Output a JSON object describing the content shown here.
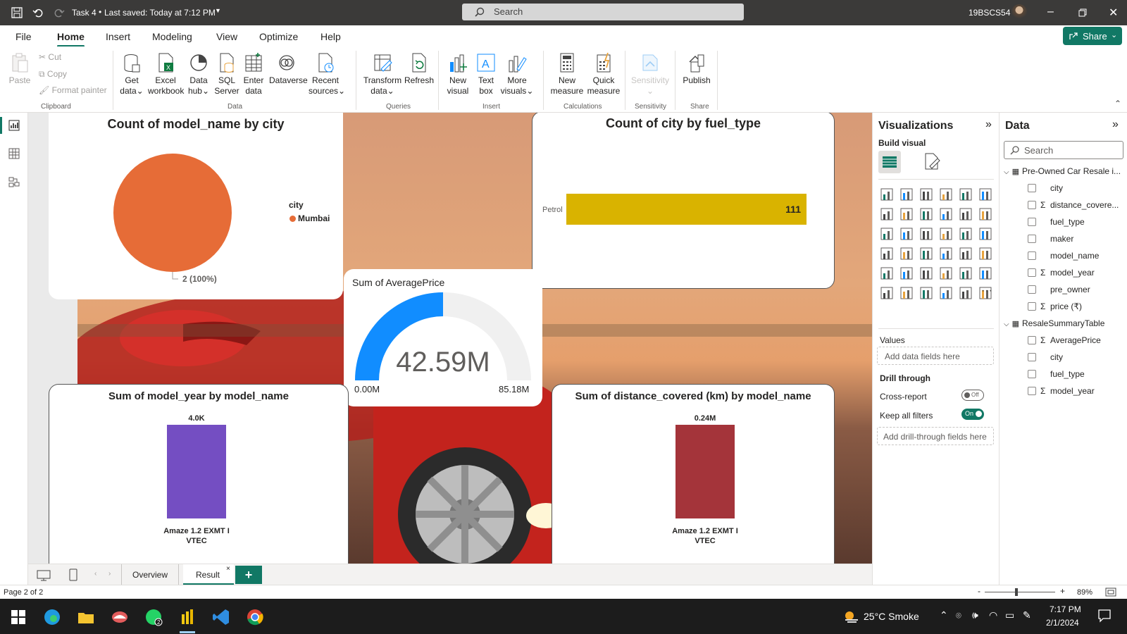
{
  "titlebar": {
    "doc_title": "Task 4",
    "saved": "Last saved: Today at 7:12 PM",
    "search_placeholder": "Search",
    "user": "19BSCS54"
  },
  "menu": {
    "items": [
      "File",
      "Home",
      "Insert",
      "Modeling",
      "View",
      "Optimize",
      "Help"
    ],
    "share": "Share"
  },
  "ribbon": {
    "clipboard": {
      "paste": "Paste",
      "cut": "Cut",
      "copy": "Copy",
      "format_painter": "Format painter",
      "group": "Clipboard"
    },
    "data": {
      "get_data": [
        "Get",
        "data"
      ],
      "excel": [
        "Excel",
        "workbook"
      ],
      "data_hub": [
        "Data",
        "hub"
      ],
      "sql": [
        "SQL",
        "Server"
      ],
      "enter": [
        "Enter",
        "data"
      ],
      "dataverse": "Dataverse",
      "recent": [
        "Recent",
        "sources"
      ],
      "group": "Data"
    },
    "queries": {
      "transform": [
        "Transform",
        "data"
      ],
      "refresh": "Refresh",
      "group": "Queries"
    },
    "insert": {
      "new_visual": [
        "New",
        "visual"
      ],
      "text_box": [
        "Text",
        "box"
      ],
      "more_visuals": [
        "More",
        "visuals"
      ],
      "group": "Insert"
    },
    "calculations": {
      "new_measure": [
        "New",
        "measure"
      ],
      "quick_measure": [
        "Quick",
        "measure"
      ],
      "group": "Calculations"
    },
    "sensitivity": {
      "label": "Sensitivity",
      "group": "Sensitivity"
    },
    "share": {
      "publish": "Publish",
      "group": "Share"
    }
  },
  "visuals": {
    "pie": {
      "title": "Count of model_name by city",
      "legend_title": "city",
      "legend_item": "Mumbai",
      "data_label": "2 (100%)",
      "color": "#E66C37"
    },
    "fuel_bar": {
      "title": "Count of city by fuel_type",
      "color": "#D9B300"
    },
    "gauge": {
      "title": "Sum of AveragePrice",
      "value_label": "42.59M",
      "min_label": "0.00M",
      "max_label": "85.18M",
      "color": "#118DFF"
    },
    "year_bar": {
      "title": "Sum of model_year by model_name",
      "color": "#744EC2"
    },
    "distance_bar": {
      "title": "Sum of distance_covered (km) by model_name",
      "color": "#A4343A"
    }
  },
  "chart_data": [
    {
      "type": "pie",
      "title": "Count of model_name by city",
      "categories": [
        "Mumbai"
      ],
      "values": [
        2
      ],
      "legend": "right"
    },
    {
      "type": "bar",
      "orientation": "horizontal",
      "title": "Count of city by fuel_type",
      "categories": [
        "Petrol"
      ],
      "values": [
        111
      ],
      "value_labels": [
        "111"
      ]
    },
    {
      "type": "gauge",
      "title": "Sum of AveragePrice",
      "value": 42.59,
      "min": 0,
      "max": 85.18,
      "unit": "M"
    },
    {
      "type": "bar",
      "title": "Sum of model_year by model_name",
      "categories": [
        "Amaze 1.2 EXMT I VTEC"
      ],
      "values": [
        4000
      ],
      "value_labels": [
        "4.0K"
      ]
    },
    {
      "type": "bar",
      "title": "Sum of distance_covered (km) by model_name",
      "categories": [
        "Amaze 1.2 EXMT I VTEC"
      ],
      "values": [
        240000
      ],
      "value_labels": [
        "0.24M"
      ]
    }
  ],
  "viz_pane": {
    "title": "Visualizations",
    "build_visual": "Build visual",
    "values_label": "Values",
    "add_fields": "Add data fields here",
    "drill_through": "Drill through",
    "cross_report": "Cross-report",
    "cross_report_state": "Off",
    "keep_filters": "Keep all filters",
    "keep_filters_state": "On",
    "add_drill": "Add drill-through fields here"
  },
  "data_pane": {
    "title": "Data",
    "search_placeholder": "Search",
    "tables": [
      {
        "name": "Pre-Owned Car Resale i...",
        "fields": [
          {
            "name": "city",
            "sigma": false
          },
          {
            "name": "distance_covere...",
            "sigma": true
          },
          {
            "name": "fuel_type",
            "sigma": false
          },
          {
            "name": "maker",
            "sigma": false
          },
          {
            "name": "model_name",
            "sigma": false
          },
          {
            "name": "model_year",
            "sigma": true
          },
          {
            "name": "pre_owner",
            "sigma": false
          },
          {
            "name": "price (₹)",
            "sigma": true
          }
        ]
      },
      {
        "name": "ResaleSummaryTable",
        "fields": [
          {
            "name": "AveragePrice",
            "sigma": true
          },
          {
            "name": "city",
            "sigma": false
          },
          {
            "name": "fuel_type",
            "sigma": false
          },
          {
            "name": "model_year",
            "sigma": true
          }
        ]
      }
    ]
  },
  "page_tabs": {
    "tabs": [
      "Overview",
      "Result"
    ],
    "active": "Result"
  },
  "status": {
    "page": "Page 2 of 2",
    "zoom": "89%"
  },
  "taskbar": {
    "weather": "25°C  Smoke",
    "time": "7:17 PM",
    "date": "2/1/2024"
  }
}
